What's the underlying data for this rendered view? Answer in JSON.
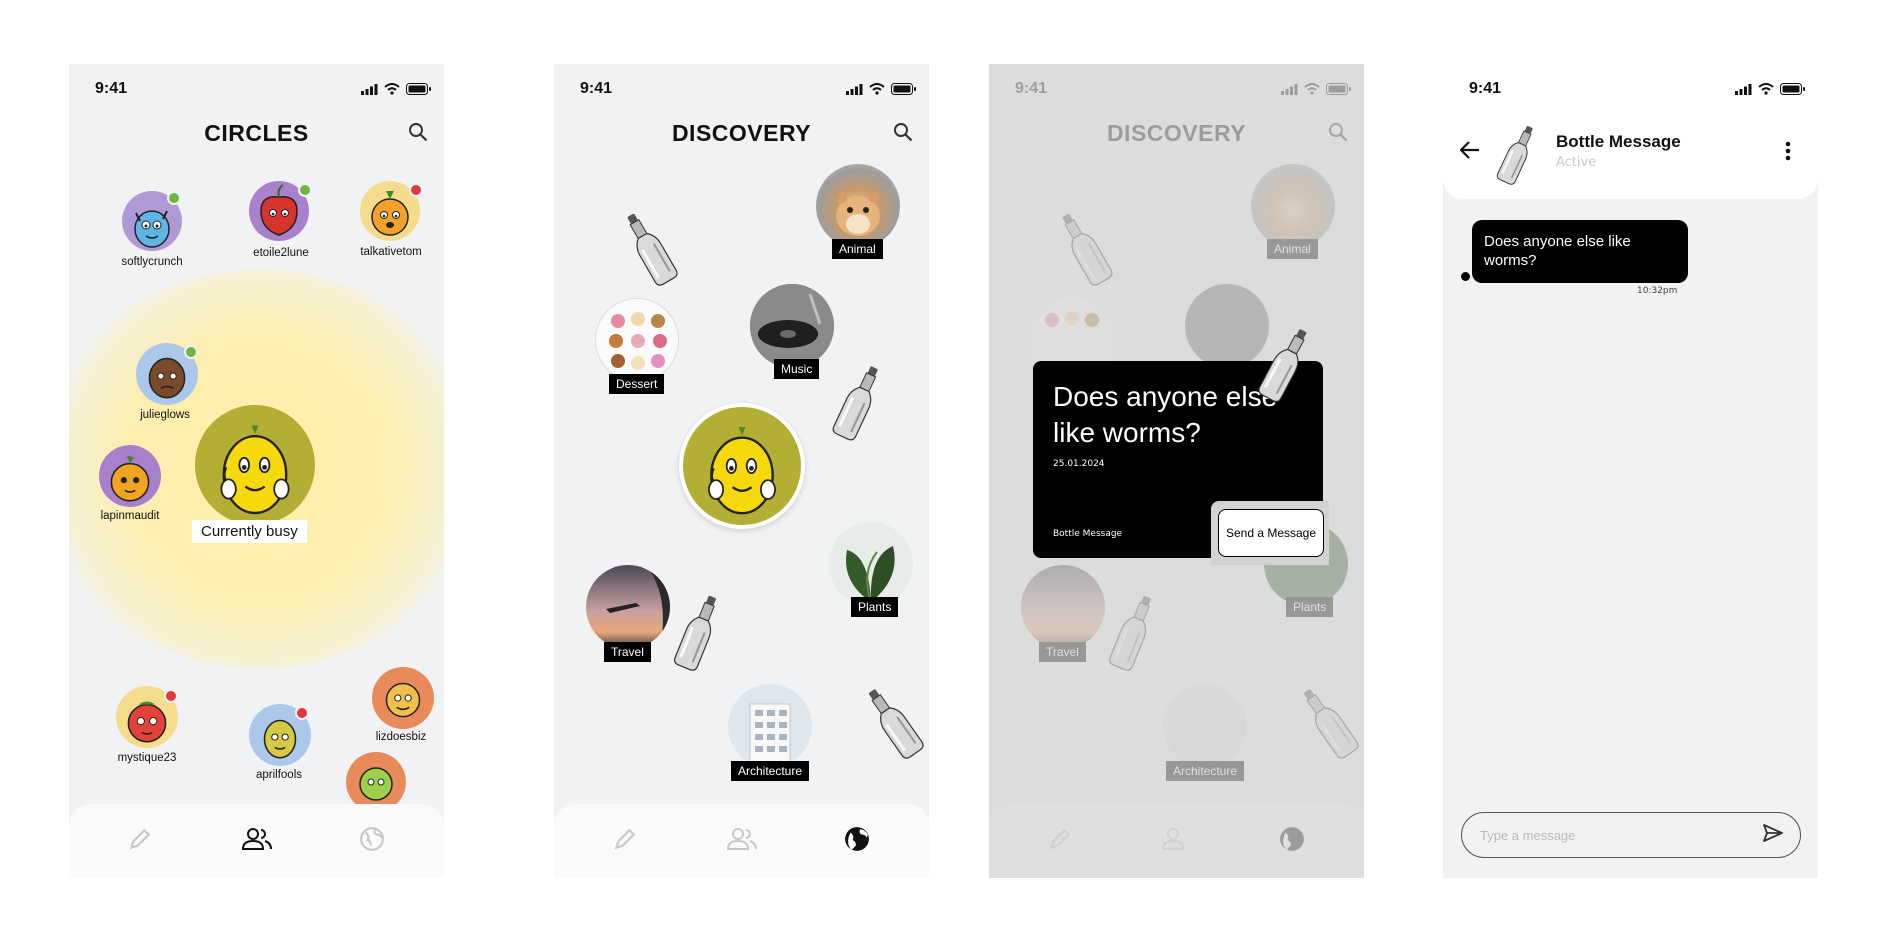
{
  "status_time": "9:41",
  "circles": {
    "title": "CIRCLES",
    "busy_label": "Currently busy",
    "users": [
      {
        "name": "softlycrunch",
        "status": "#6fb53f"
      },
      {
        "name": "etoile2lune",
        "status": "#6fb53f"
      },
      {
        "name": "talkativetom",
        "status": "#e0383e"
      },
      {
        "name": "julieglows",
        "status": "#6fb53f"
      },
      {
        "name": "lapinmaudit",
        "status": ""
      },
      {
        "name": "mystique23",
        "status": "#e0383e"
      },
      {
        "name": "aprilfools",
        "status": "#e0383e"
      },
      {
        "name": "lizdoesbiz",
        "status": ""
      }
    ]
  },
  "discovery": {
    "title": "DISCOVERY",
    "topics": [
      "Animal",
      "Dessert",
      "Music",
      "Plants",
      "Travel",
      "Architecture"
    ]
  },
  "bottle_card": {
    "question": "Does anyone else like worms?",
    "date": "25.01.2024",
    "source": "Bottle Message",
    "send_label": "Send a Message"
  },
  "chat": {
    "name": "Bottle Message",
    "status": "Active",
    "message": "Does anyone else like worms?",
    "time": "10:32pm",
    "input_placeholder": "Type a message"
  },
  "tabs": [
    "pencil-icon",
    "people-icon",
    "globe-icon"
  ],
  "colors": {
    "accent_yellow": "#fbeeb0",
    "online": "#6fb53f",
    "busy": "#e0383e"
  }
}
